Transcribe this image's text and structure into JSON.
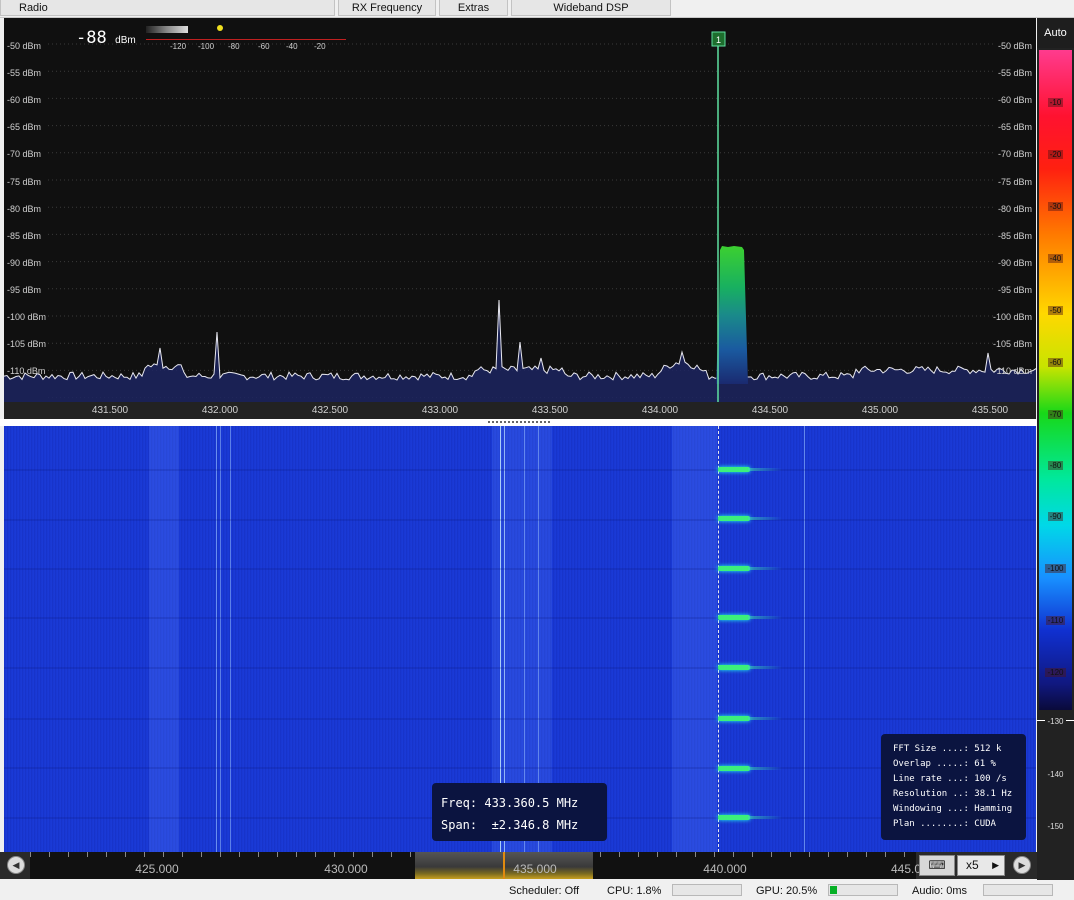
{
  "tabs": [
    "Radio",
    "RX Frequency",
    "Extras",
    "Wideband DSP"
  ],
  "spectrum": {
    "power_readout": "-88",
    "power_unit": "dBm",
    "meter_scale": [
      "-120",
      "-100",
      "-80",
      "-60",
      "-40",
      "-20"
    ],
    "left_db_labels": [
      "-50 dBm",
      "-55 dBm",
      "-60 dBm",
      "-65 dBm",
      "-70 dBm",
      "-75 dBm",
      "-80 dBm",
      "-85 dBm",
      "-90 dBm",
      "-95 dBm",
      "-100 dBm",
      "-105 dBm",
      "-110 dBm"
    ],
    "right_db_labels": [
      "-50 dBm",
      "-55 dBm",
      "-60 dBm",
      "-65 dBm",
      "-70 dBm",
      "-75 dBm",
      "-80 dBm",
      "-85 dBm",
      "-90 dBm",
      "-95 dBm",
      "-100 dBm",
      "-105 dBm",
      "-110 dBm"
    ],
    "freq_labels": [
      "431.500",
      "432.000",
      "432.500",
      "433.000",
      "433.500",
      "434.000",
      "434.500",
      "435.000",
      "435.500"
    ],
    "vfo_marker": "1"
  },
  "colorbar": {
    "auto_label": "Auto",
    "ticks": [
      "-10",
      "-20",
      "-30",
      "-40",
      "-50",
      "-60",
      "-70",
      "-80",
      "-90",
      "-100",
      "-110",
      "-120",
      "-130",
      "-140",
      "-150"
    ]
  },
  "waterfall_info": {
    "fft_size": "FFT Size ....: 512 k",
    "overlap": "Overlap .....: 61 %",
    "line_rate": "Line rate ...: 100 /s",
    "resolution": "Resolution ..: 38.1 Hz",
    "windowing": "Windowing ...: Hamming",
    "plan": "Plan ........: CUDA"
  },
  "cursor_info": {
    "freq": "Freq: 433.360.5 MHz",
    "span": "Span:  ±2.346.8 MHz"
  },
  "scroll_labels": [
    "425.000",
    "430.000",
    "435.000",
    "440.000",
    "445.0"
  ],
  "zoom_label": "x5",
  "status": {
    "scheduler": "Scheduler: Off",
    "cpu": "CPU: 1.8%",
    "gpu": "GPU: 20.5%",
    "gpu_level": 0.1,
    "audio": "Audio: 0ms"
  }
}
